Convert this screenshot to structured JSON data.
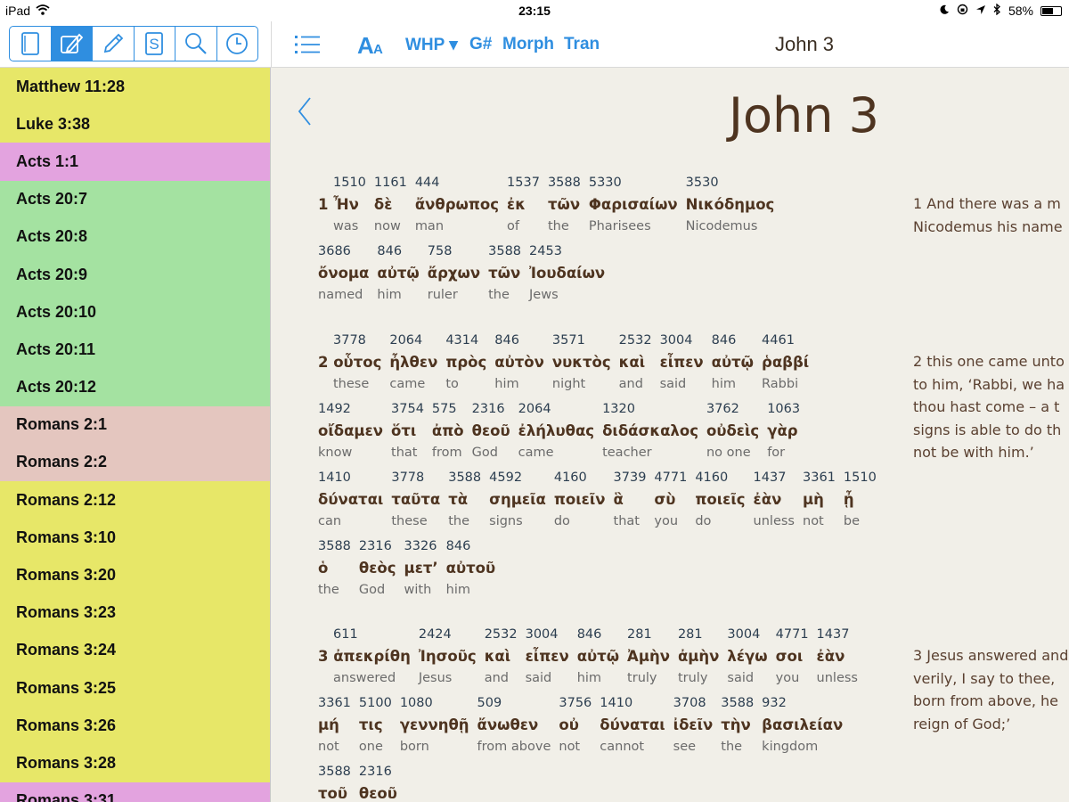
{
  "status": {
    "device": "iPad",
    "time": "23:15",
    "battery": "58%",
    "battery_level": 0.58
  },
  "toolbar": {
    "tabs": [
      "book-icon",
      "pencil-square-icon",
      "pencil-icon",
      "s-icon",
      "search-icon",
      "clock-icon"
    ],
    "active_tab": 1,
    "version": "WHP ▾",
    "gnum": "G#",
    "morph": "Morph",
    "tran": "Tran",
    "title": "John 3"
  },
  "sidebar": {
    "items": [
      {
        "label": "Matthew 11:28",
        "color": "#e7e768"
      },
      {
        "label": "Luke 3:38",
        "color": "#e7e768"
      },
      {
        "label": "Acts 1:1",
        "color": "#e3a3df"
      },
      {
        "label": "Acts 20:7",
        "color": "#a4e2a1"
      },
      {
        "label": "Acts 20:8",
        "color": "#a4e2a1"
      },
      {
        "label": "Acts 20:9",
        "color": "#a4e2a1"
      },
      {
        "label": "Acts 20:10",
        "color": "#a4e2a1"
      },
      {
        "label": "Acts 20:11",
        "color": "#a4e2a1"
      },
      {
        "label": "Acts 20:12",
        "color": "#a4e2a1"
      },
      {
        "label": "Romans 2:1",
        "color": "#e4c6bf"
      },
      {
        "label": "Romans 2:2",
        "color": "#e4c6bf"
      },
      {
        "label": "Romans 2:12",
        "color": "#e7e768"
      },
      {
        "label": "Romans 3:10",
        "color": "#e7e768"
      },
      {
        "label": "Romans 3:20",
        "color": "#e7e768"
      },
      {
        "label": "Romans 3:23",
        "color": "#e7e768"
      },
      {
        "label": "Romans 3:24",
        "color": "#e7e768"
      },
      {
        "label": "Romans 3:25",
        "color": "#e7e768"
      },
      {
        "label": "Romans 3:26",
        "color": "#e7e768"
      },
      {
        "label": "Romans 3:28",
        "color": "#e7e768"
      },
      {
        "label": "Romans 3:31",
        "color": "#e3a3df"
      }
    ]
  },
  "main": {
    "chapter_title": "John 3",
    "verses": [
      {
        "translation": [
          "1 And there was a m",
          "Nicodemus his name"
        ],
        "lines": [
          [
            {
              "n": "1510",
              "g": "1 Ἦν",
              "e": "was"
            },
            {
              "n": "1161",
              "g": "δὲ",
              "e": "now"
            },
            {
              "n": "444",
              "g": "ἄνθρωπος",
              "e": "man"
            },
            {
              "n": "1537",
              "g": "ἐκ",
              "e": "of"
            },
            {
              "n": "3588",
              "g": "τῶν",
              "e": "the"
            },
            {
              "n": "5330",
              "g": "Φαρισαίων",
              "e": "Pharisees"
            },
            {
              "n": "3530",
              "g": "Νικόδημος",
              "e": "Nicodemus"
            }
          ],
          [
            {
              "n": "3686",
              "g": "ὄνομα",
              "e": "named"
            },
            {
              "n": "846",
              "g": "αὐτῷ",
              "e": "him"
            },
            {
              "n": "758",
              "g": "ἄρχων",
              "e": "ruler"
            },
            {
              "n": "3588",
              "g": "τῶν",
              "e": "the"
            },
            {
              "n": "2453",
              "g": "Ἰουδαίων",
              "e": "Jews"
            }
          ]
        ]
      },
      {
        "translation": [
          "2 this one came unto",
          "to him, ‘Rabbi, we ha",
          "thou hast come – a t",
          "signs is able to do th",
          "not be with him.’"
        ],
        "lines": [
          [
            {
              "n": "3778",
              "g": "2 οὗτος",
              "e": "these"
            },
            {
              "n": "2064",
              "g": "ἦλθεν",
              "e": "came"
            },
            {
              "n": "4314",
              "g": "πρὸς",
              "e": "to"
            },
            {
              "n": "846",
              "g": "αὐτὸν",
              "e": "him"
            },
            {
              "n": "3571",
              "g": "νυκτὸς",
              "e": "night"
            },
            {
              "n": "2532",
              "g": "καὶ",
              "e": "and"
            },
            {
              "n": "3004",
              "g": "εἶπεν",
              "e": "said"
            },
            {
              "n": "846",
              "g": "αὐτῷ",
              "e": "him"
            },
            {
              "n": "4461",
              "g": "ῥαββί",
              "e": "Rabbi"
            }
          ],
          [
            {
              "n": "1492",
              "g": "οἴδαμεν",
              "e": "know"
            },
            {
              "n": "3754",
              "g": "ὅτι",
              "e": "that"
            },
            {
              "n": "575",
              "g": "ἀπὸ",
              "e": "from"
            },
            {
              "n": "2316",
              "g": "θεοῦ",
              "e": "God"
            },
            {
              "n": "2064",
              "g": "ἐλήλυθας",
              "e": "came"
            },
            {
              "n": "1320",
              "g": "διδάσκαλος",
              "e": "teacher"
            },
            {
              "n": "3762",
              "g": "οὐδεὶς",
              "e": "no one"
            },
            {
              "n": "1063",
              "g": "γὰρ",
              "e": "for"
            }
          ],
          [
            {
              "n": "1410",
              "g": "δύναται",
              "e": "can"
            },
            {
              "n": "3778",
              "g": "ταῦτα",
              "e": "these"
            },
            {
              "n": "3588",
              "g": "τὰ",
              "e": "the"
            },
            {
              "n": "4592",
              "g": "σημεῖα",
              "e": "signs"
            },
            {
              "n": "4160",
              "g": "ποιεῖν",
              "e": "do"
            },
            {
              "n": "3739",
              "g": "ἃ",
              "e": "that"
            },
            {
              "n": "4771",
              "g": "σὺ",
              "e": "you"
            },
            {
              "n": "4160",
              "g": "ποιεῖς",
              "e": "do"
            },
            {
              "n": "1437",
              "g": "ἐὰν",
              "e": "unless"
            },
            {
              "n": "3361",
              "g": "μὴ",
              "e": "not"
            },
            {
              "n": "1510",
              "g": "ᾖ",
              "e": "be"
            }
          ],
          [
            {
              "n": "3588",
              "g": "ὁ",
              "e": "the"
            },
            {
              "n": "2316",
              "g": "θεὸς",
              "e": "God"
            },
            {
              "n": "3326",
              "g": "μετ’",
              "e": "with"
            },
            {
              "n": "846",
              "g": "αὐτοῦ",
              "e": "him"
            }
          ]
        ]
      },
      {
        "translation": [
          "3 Jesus answered and",
          "verily, I say to thee,",
          "born from above, he",
          "reign of God;’"
        ],
        "lines": [
          [
            {
              "n": "611",
              "g": "3 ἀπεκρίθη",
              "e": "answered"
            },
            {
              "n": "2424",
              "g": "Ἰησοῦς",
              "e": "Jesus"
            },
            {
              "n": "2532",
              "g": "καὶ",
              "e": "and"
            },
            {
              "n": "3004",
              "g": "εἶπεν",
              "e": "said"
            },
            {
              "n": "846",
              "g": "αὐτῷ",
              "e": "him"
            },
            {
              "n": "281",
              "g": "Ἀμὴν",
              "e": "truly"
            },
            {
              "n": "281",
              "g": "ἀμὴν",
              "e": "truly"
            },
            {
              "n": "3004",
              "g": "λέγω",
              "e": "said"
            },
            {
              "n": "4771",
              "g": "σοι",
              "e": "you"
            },
            {
              "n": "1437",
              "g": "ἐὰν",
              "e": "unless"
            }
          ],
          [
            {
              "n": "3361",
              "g": "μή",
              "e": "not"
            },
            {
              "n": "5100",
              "g": "τις",
              "e": "one"
            },
            {
              "n": "1080",
              "g": "γεννηθῇ",
              "e": "born"
            },
            {
              "n": "509",
              "g": "ἄνωθεν",
              "e": "from above"
            },
            {
              "n": "3756",
              "g": "οὐ",
              "e": "not"
            },
            {
              "n": "1410",
              "g": "δύναται",
              "e": "cannot"
            },
            {
              "n": "3708",
              "g": "ἰδεῖν",
              "e": "see"
            },
            {
              "n": "3588",
              "g": "τὴν",
              "e": "the"
            },
            {
              "n": "932",
              "g": "βασιλείαν",
              "e": "kingdom"
            }
          ],
          [
            {
              "n": "3588",
              "g": "τοῦ",
              "e": ""
            },
            {
              "n": "2316",
              "g": "θεοῦ",
              "e": ""
            }
          ]
        ]
      }
    ]
  }
}
